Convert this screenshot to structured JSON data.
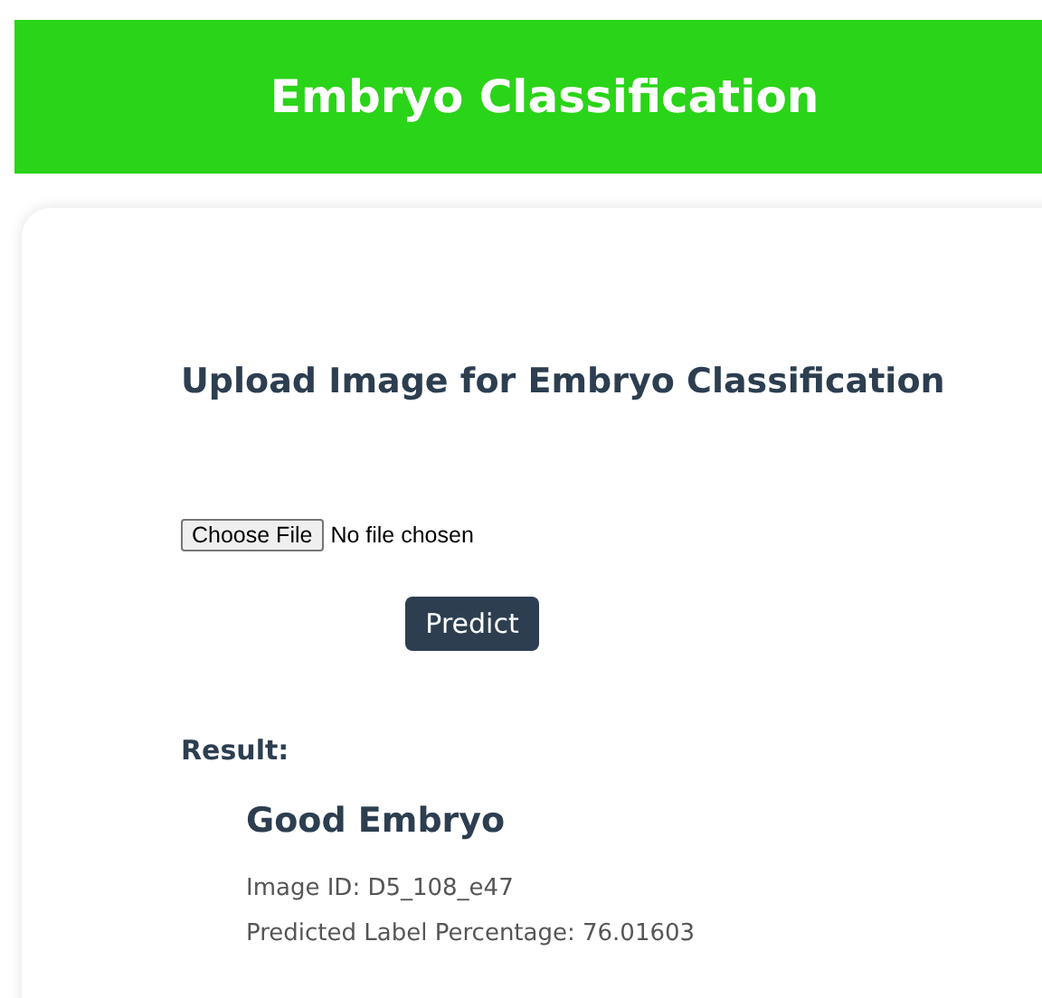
{
  "header": {
    "title": "Embryo Classification"
  },
  "upload": {
    "heading": "Upload Image for Embryo Classification",
    "file_button": "Choose File",
    "file_status": "No file chosen",
    "submit": "Predict"
  },
  "result": {
    "label": "Result:",
    "prediction": "Good Embryo",
    "details": [
      "Image ID: D5_108_e47",
      "Predicted Label Percentage: 76.01603"
    ]
  }
}
